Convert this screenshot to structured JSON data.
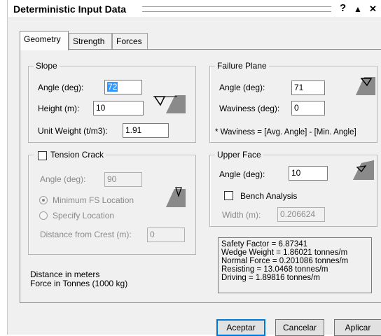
{
  "window": {
    "title": "Deterministic Input Data",
    "help_symbol": "?",
    "collapse_symbol": "▲",
    "close_symbol": "✕"
  },
  "tabs": [
    {
      "label": "Geometry",
      "active": true
    },
    {
      "label": "Strength",
      "active": false
    },
    {
      "label": "Forces",
      "active": false
    }
  ],
  "slope": {
    "title": "Slope",
    "angle_label": "Angle (deg):",
    "angle_value": "72",
    "height_label": "Height (m):",
    "height_value": "10",
    "unit_weight_label": "Unit Weight (t/m3):",
    "unit_weight_value": "1.91"
  },
  "failure_plane": {
    "title": "Failure Plane",
    "angle_label": "Angle (deg):",
    "angle_value": "71",
    "waviness_label": "Waviness (deg):",
    "waviness_value": "0",
    "note": "* Waviness = [Avg. Angle] - [Min. Angle]"
  },
  "tension_crack": {
    "title": "Tension Crack",
    "checked": false,
    "angle_label": "Angle (deg):",
    "angle_value": "90",
    "option_min_fs": "Minimum FS Location",
    "option_specify": "Specify Location",
    "selected_option": "Minimum FS Location",
    "distance_label": "Distance from Crest (m):",
    "distance_value": "0"
  },
  "upper_face": {
    "title": "Upper Face",
    "angle_label": "Angle (deg):",
    "angle_value": "10",
    "bench_label": "Bench Analysis",
    "bench_checked": false,
    "width_label": "Width (m):",
    "width_value": "0.206624"
  },
  "units_note": {
    "line1": "Distance in meters",
    "line2": "Force in Tonnes (1000 kg)"
  },
  "results": {
    "safety_factor": "Safety Factor = 6.87341",
    "wedge_weight": "Wedge Weight = 1.86021 tonnes/m",
    "normal_force": "Normal Force = 0.201086 tonnes/m",
    "resisting": "Resisting = 13.0468 tonnes/m",
    "driving": "Driving = 1.89816 tonnes/m"
  },
  "buttons": {
    "accept": "Aceptar",
    "cancel": "Cancelar",
    "apply": "Aplicar"
  },
  "colors": {
    "selection": "#3399ff",
    "dialog_bg": "#f0f0f0",
    "icon_fill": "#6e6e6e"
  }
}
